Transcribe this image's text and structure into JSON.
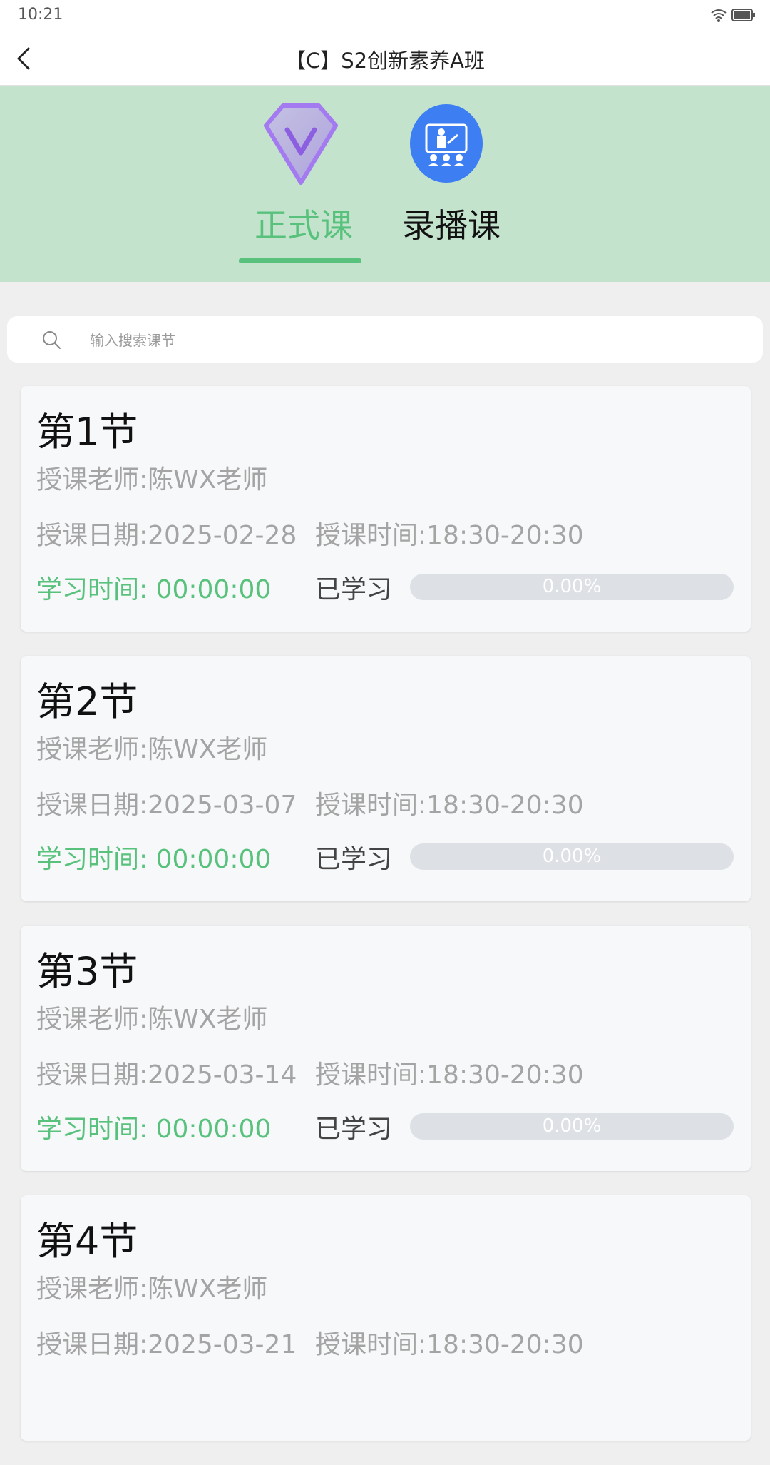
{
  "status": {
    "time": "10:21",
    "icons": [
      "wifi-icon",
      "battery-icon"
    ]
  },
  "header": {
    "title": "【C】S2创新素养A班"
  },
  "tabs": [
    {
      "label": "正式课",
      "icon": "diamond-icon",
      "active": true
    },
    {
      "label": "录播课",
      "icon": "classroom-icon",
      "active": false
    }
  ],
  "search": {
    "placeholder": "输入搜索课节"
  },
  "lessons": [
    {
      "title": "第1节",
      "teacher": "授课老师:陈WX老师",
      "date": "授课日期:2025-02-28",
      "time": "授课时间:18:30-20:30",
      "study_time": "学习时间: 00:00:00",
      "learned_label": "已学习",
      "progress_text": "0.00%",
      "progress": 0
    },
    {
      "title": "第2节",
      "teacher": "授课老师:陈WX老师",
      "date": "授课日期:2025-03-07",
      "time": "授课时间:18:30-20:30",
      "study_time": "学习时间: 00:00:00",
      "learned_label": "已学习",
      "progress_text": "0.00%",
      "progress": 0
    },
    {
      "title": "第3节",
      "teacher": "授课老师:陈WX老师",
      "date": "授课日期:2025-03-14",
      "time": "授课时间:18:30-20:30",
      "study_time": "学习时间: 00:00:00",
      "learned_label": "已学习",
      "progress_text": "0.00%",
      "progress": 0
    },
    {
      "title": "第4节",
      "teacher": "授课老师:陈WX老师",
      "date": "授课日期:2025-03-21",
      "time": "授课时间:18:30-20:30",
      "study_time": "",
      "learned_label": "",
      "progress_text": "",
      "progress": 0
    }
  ],
  "colors": {
    "accent": "#58c27d",
    "hero_bg": "#c3e3cd",
    "progress_track": "#dde0e4"
  }
}
